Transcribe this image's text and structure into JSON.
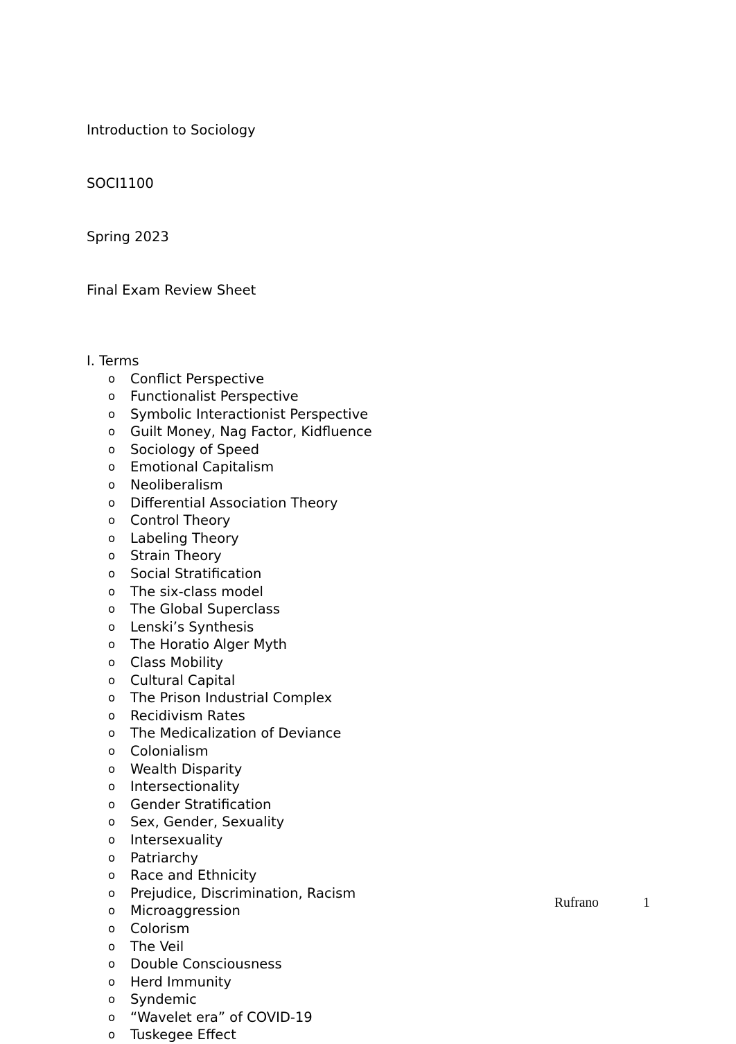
{
  "document": {
    "header_lines": [
      "Introduction to Sociology",
      "SOCI1100",
      "Spring 2023",
      "Final Exam Review Sheet"
    ],
    "sections": [
      {
        "heading": "I. Terms",
        "bullet_glyph": "o",
        "items": [
          "Conflict Perspective",
          "Functionalist Perspective",
          "Symbolic Interactionist Perspective",
          "Guilt Money, Nag Factor, Kidfluence",
          "Sociology of Speed",
          "Emotional Capitalism",
          "Neoliberalism",
          "Differential Association Theory",
          "Control Theory",
          "Labeling Theory",
          "Strain Theory",
          "Social Stratification",
          "The six-class model",
          "The Global Superclass",
          "Lenski’s Synthesis",
          "The Horatio Alger Myth",
          "Class Mobility",
          "Cultural Capital",
          "The Prison Industrial Complex",
          "Recidivism Rates",
          "The Medicalization of Deviance",
          "Colonialism",
          "Wealth Disparity",
          "Intersectionality",
          "Gender Stratification",
          "Sex, Gender, Sexuality",
          "Intersexuality",
          "Patriarchy",
          "Race and Ethnicity",
          "Prejudice, Discrimination, Racism",
          "Microaggression",
          "Colorism",
          "The Veil",
          "Double Consciousness",
          "Herd Immunity",
          "Syndemic",
          "“Wavelet era” of COVID-19",
          "Tuskegee Effect"
        ]
      }
    ],
    "footer": {
      "author": "Rufrano",
      "page_number": "1"
    },
    "colors": {
      "page_background": "#ffffff",
      "text": "#000000"
    }
  }
}
